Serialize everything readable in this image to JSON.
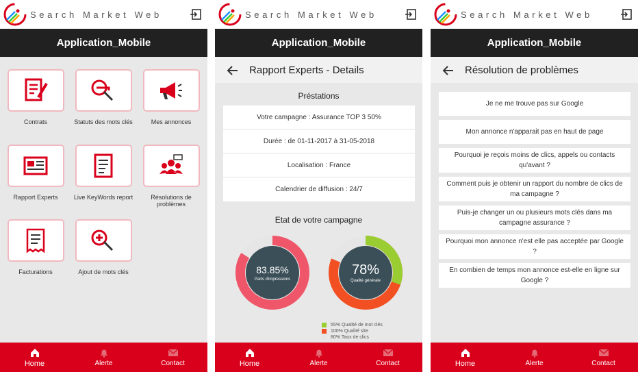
{
  "brand": "Search Market Web",
  "app_title": "Application_Mobile",
  "colors": {
    "accent": "#d9001b",
    "dark": "#212121",
    "donut_red": "#f0566a",
    "donut_green": "#9acd32",
    "donut_orange": "#f25022",
    "donut_grey": "#e6e6e6",
    "center": "#3a4f57"
  },
  "nav": {
    "home": "Home",
    "alert": "Alerte",
    "contact": "Contact"
  },
  "home": {
    "tiles": [
      {
        "label": "Contrats",
        "icon": "contract-icon"
      },
      {
        "label": "Statuts des mots clés",
        "icon": "key-search-icon"
      },
      {
        "label": "Mes annonces",
        "icon": "megaphone-icon"
      },
      {
        "label": "Rapport Experts",
        "icon": "newspaper-icon"
      },
      {
        "label": "Live KeyWords report",
        "icon": "report-icon"
      },
      {
        "label": "Résolutions de problèmes",
        "icon": "group-icon"
      },
      {
        "label": "Facturations",
        "icon": "invoice-icon"
      },
      {
        "label": "Ajout de mots clés",
        "icon": "add-key-icon"
      }
    ]
  },
  "details": {
    "title": "Rapport Experts - Details",
    "prestations_title": "Préstations",
    "rows": [
      "Votre campagne : Assurance TOP 3 50%",
      "Durée : de 01-11-2017 à 31-05-2018",
      "Localisation : France",
      "Calendrier de diffusion : 24/7"
    ],
    "state_title": "Etat de votre campagne",
    "donut1": {
      "value": "83.85%",
      "label": "Parts d'impressions",
      "fraction": 0.8385
    },
    "donut2": {
      "value": "78%",
      "label": "Qualité générale",
      "segments": [
        0.55,
        1.0,
        0.8
      ]
    },
    "legend": [
      {
        "text": "55% Qualité de mot clés",
        "color": "#9acd32"
      },
      {
        "text": "100% Qualité site",
        "color": "#f25022"
      },
      {
        "text": "80% Taux de clics",
        "color": "#e6e6e6"
      }
    ]
  },
  "problems": {
    "title": "Résolution de problèmes",
    "items": [
      "Je ne me trouve pas sur Google",
      "Mon annonce n'apparait pas en haut de page",
      "Pourquoi je reçois moins de clics, appels ou contacts qu'avant ?",
      "Comment puis je obtenir un rapport du nombre de clics de ma campagne ?",
      "Puis-je changer un ou plusieurs mots clés dans ma campagne assurance ?",
      "Pourquoi mon annonce n'est elle pas acceptée par Google ?",
      "En combien de temps mon annonce est-elle en ligne sur Google ?"
    ]
  }
}
